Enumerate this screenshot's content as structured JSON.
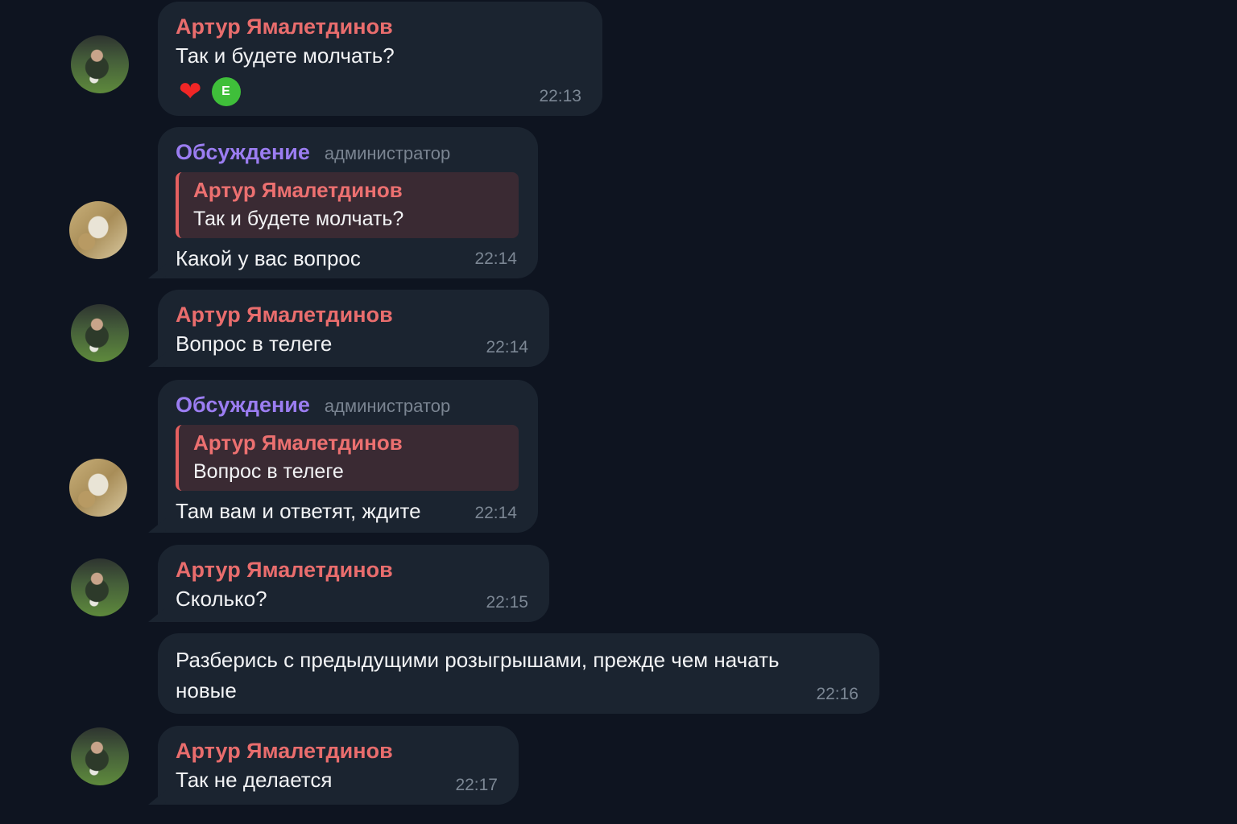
{
  "colors": {
    "background": "#0e1420",
    "bubble": "#1b2430",
    "sender_artur": "#e96d6d",
    "sender_admin": "#9b7df1",
    "reply_background": "#3a2a33",
    "reply_bar": "#e56060",
    "reaction_avatar": "#3fbf3a"
  },
  "messages": [
    {
      "sender": "Артур Ямалетдинов",
      "text": "Так и будете молчать?",
      "time": "22:13",
      "reactions": {
        "emoji": "❤",
        "icon": "heart-icon",
        "reactor_initial": "E"
      }
    },
    {
      "sender": "Обсуждение",
      "role": "администратор",
      "reply": {
        "name": "Артур Ямалетдинов",
        "text": "Так и будете молчать?"
      },
      "text": "Какой у вас вопрос",
      "time": "22:14"
    },
    {
      "sender": "Артур Ямалетдинов",
      "text": "Вопрос в телеге",
      "time": "22:14"
    },
    {
      "sender": "Обсуждение",
      "role": "администратор",
      "reply": {
        "name": "Артур Ямалетдинов",
        "text": "Вопрос в телеге"
      },
      "text": "Там вам и ответят, ждите",
      "time": "22:14"
    },
    {
      "sender": "Артур Ямалетдинов",
      "text": "Сколько?",
      "time": "22:15"
    },
    {
      "text_line1": "Разберись с предыдущими розыгрышами, прежде чем начать",
      "text_line2": "новые",
      "time": "22:16"
    },
    {
      "sender": "Артур Ямалетдинов",
      "text": "Так не делается",
      "time": "22:17"
    }
  ]
}
